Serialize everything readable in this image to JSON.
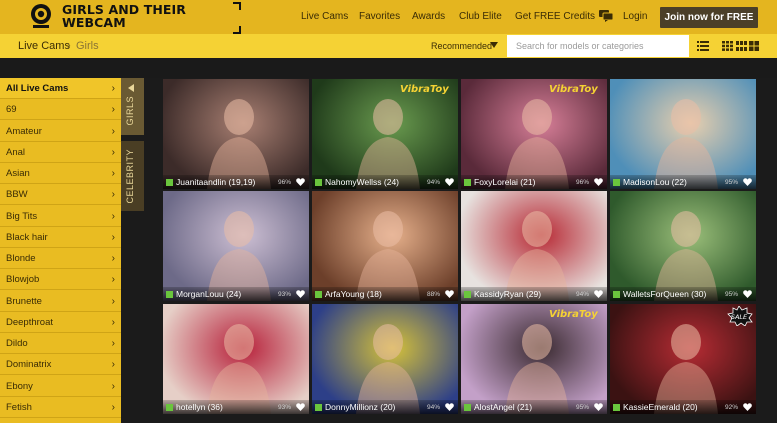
{
  "header": {
    "logo_line1": "GIRLS AND THEIR",
    "logo_line2": "WEBCAM",
    "nav": [
      "Live Cams",
      "Favorites",
      "Awards",
      "Club Elite",
      "Get FREE Credits",
      "Login"
    ],
    "join_label": "Join now for FREE"
  },
  "subheader": {
    "crumb_root": "Live Cams",
    "crumb_sep": "›",
    "crumb_current": "Girls",
    "sort_label": "Recommended",
    "search_placeholder": "Search for models or categories"
  },
  "sidebar": {
    "items": [
      "All Live Cams",
      "69",
      "Amateur",
      "Anal",
      "Asian",
      "BBW",
      "Big Tits",
      "Black hair",
      "Blonde",
      "Blowjob",
      "Brunette",
      "Deepthroat",
      "Dildo",
      "Dominatrix",
      "Ebony",
      "Fetish"
    ],
    "active_index": 0,
    "tab_girls": "GIRLS",
    "tab_celebrity": "CELEBRITY"
  },
  "badge_text": "VibraToy",
  "sale_text": "SALE",
  "colors": {
    "header": "#e4b51f",
    "subheader": "#f5d234",
    "sidebar": "#e9bc22",
    "join_button": "#4b3f28",
    "online_dot": "#6ac53d"
  },
  "models": [
    {
      "name": "Juanitaandlin (19,19)",
      "rating": "96%",
      "badge": false,
      "sale": false,
      "bg": [
        "#3c2b29",
        "#a87f72"
      ]
    },
    {
      "name": "NahomyWellss (24)",
      "rating": "94%",
      "badge": true,
      "sale": false,
      "bg": [
        "#1f3a1a",
        "#6a9b4f"
      ]
    },
    {
      "name": "FoxyLorelai (21)",
      "rating": "96%",
      "badge": true,
      "sale": false,
      "bg": [
        "#5a2a3a",
        "#d77f98"
      ]
    },
    {
      "name": "MadisonLou (22)",
      "rating": "95%",
      "badge": false,
      "sale": false,
      "bg": [
        "#4f8fb8",
        "#e8cfae"
      ]
    },
    {
      "name": "MorganLouu (24)",
      "rating": "93%",
      "badge": false,
      "sale": false,
      "bg": [
        "#6d6a88",
        "#cdbfd3"
      ]
    },
    {
      "name": "ArfaYoung (18)",
      "rating": "88%",
      "badge": false,
      "sale": false,
      "bg": [
        "#6c3f2a",
        "#e6b08b"
      ]
    },
    {
      "name": "KassidyRyan (29)",
      "rating": "94%",
      "badge": false,
      "sale": false,
      "bg": [
        "#e7e2df",
        "#b72934"
      ]
    },
    {
      "name": "WalletsForQueen (30)",
      "rating": "95%",
      "badge": false,
      "sale": false,
      "bg": [
        "#2f5a2c",
        "#9bbf7a"
      ]
    },
    {
      "name": "hotellyn (36)",
      "rating": "93%",
      "badge": false,
      "sale": false,
      "bg": [
        "#e6cfc7",
        "#b7203a"
      ]
    },
    {
      "name": "DonnyMillionz (20)",
      "rating": "94%",
      "badge": false,
      "sale": false,
      "bg": [
        "#2d3f88",
        "#d6c239"
      ]
    },
    {
      "name": "AlostAngel (21)",
      "rating": "95%",
      "badge": true,
      "sale": false,
      "bg": [
        "#c3a0c8",
        "#3a2a30"
      ]
    },
    {
      "name": "KassieEmerald (20)",
      "rating": "92%",
      "badge": false,
      "sale": true,
      "bg": [
        "#3b1212",
        "#b72c34"
      ]
    }
  ]
}
